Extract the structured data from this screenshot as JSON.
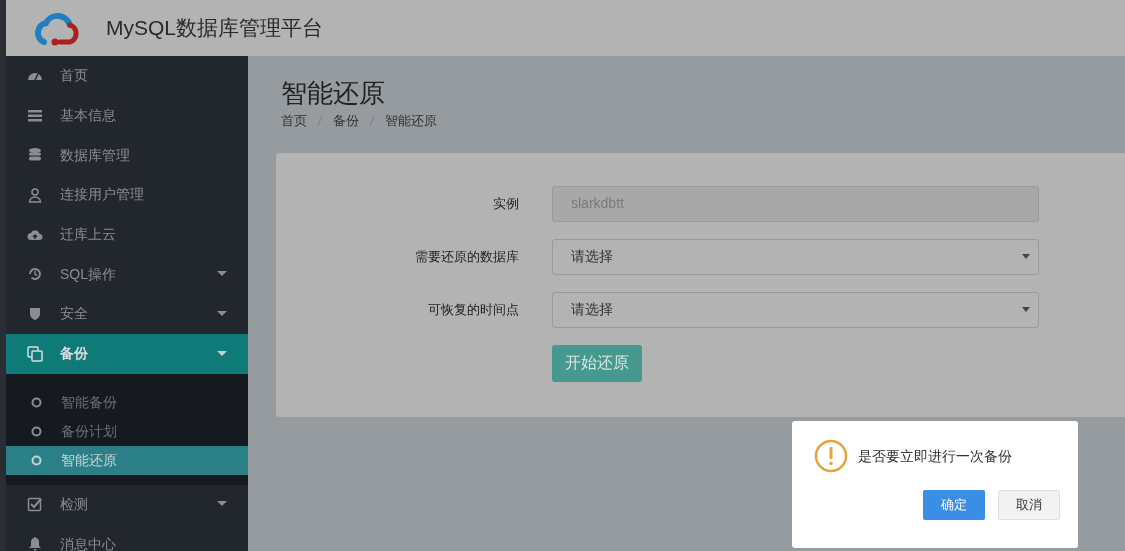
{
  "header": {
    "title": "MySQL数据库管理平台"
  },
  "sidebar": {
    "items": [
      {
        "label": "首页",
        "selected": false
      },
      {
        "label": "基本信息",
        "selected": false
      },
      {
        "label": "数据库管理",
        "selected": false
      },
      {
        "label": "连接用户管理",
        "selected": false
      },
      {
        "label": "迁库上云",
        "selected": false
      },
      {
        "label": "SQL操作",
        "selected": false,
        "expanded": false
      },
      {
        "label": "安全",
        "selected": false,
        "expanded": false
      },
      {
        "label": "备份",
        "selected": true,
        "expanded": true,
        "children": [
          {
            "label": "智能备份",
            "selected": false
          },
          {
            "label": "备份计划",
            "selected": false
          },
          {
            "label": "智能还原",
            "selected": true
          }
        ]
      },
      {
        "label": "检测",
        "selected": false,
        "expanded": false
      },
      {
        "label": "消息中心",
        "selected": false
      }
    ]
  },
  "page": {
    "title": "智能还原",
    "breadcrumb": [
      "首页",
      "备份",
      "智能还原"
    ]
  },
  "form": {
    "fields": [
      {
        "label": "实例",
        "kind": "input",
        "value": "slarkdbtt",
        "disabled": true
      },
      {
        "label": "需要还原的数据库",
        "kind": "select",
        "placeholder": "请选择",
        "disabled": false
      },
      {
        "label": "可恢复的时间点",
        "kind": "select",
        "placeholder": "请选择",
        "disabled": false
      }
    ],
    "submit": "开始还原"
  },
  "dialog": {
    "message": "是否要立即进行一次备份",
    "buttons": [
      {
        "label": "确定",
        "kind": "primary"
      },
      {
        "label": "取消",
        "kind": "default"
      }
    ]
  }
}
